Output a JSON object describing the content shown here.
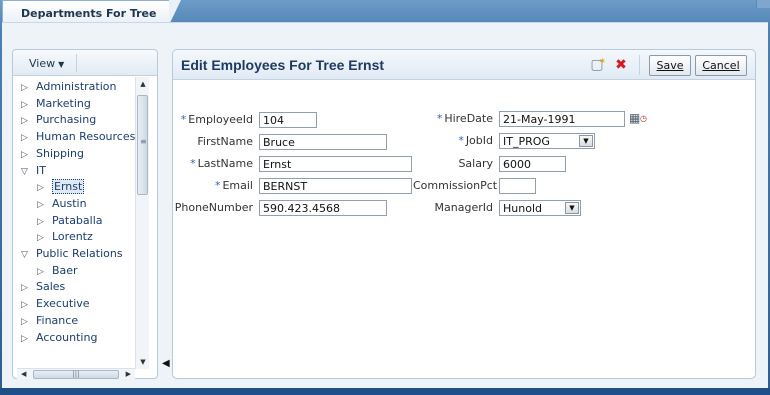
{
  "window": {
    "tab_title": "Departments For Tree"
  },
  "left": {
    "view_label": "View",
    "tree": [
      {
        "label": "Administration",
        "expanded": false,
        "level": 0
      },
      {
        "label": "Marketing",
        "expanded": false,
        "level": 0
      },
      {
        "label": "Purchasing",
        "expanded": false,
        "level": 0
      },
      {
        "label": "Human Resources",
        "expanded": false,
        "level": 0
      },
      {
        "label": "Shipping",
        "expanded": false,
        "level": 0
      },
      {
        "label": "IT",
        "expanded": true,
        "level": 0
      },
      {
        "label": "Ernst",
        "expanded": false,
        "level": 1,
        "selected": true
      },
      {
        "label": "Austin",
        "expanded": false,
        "level": 1
      },
      {
        "label": "Pataballa",
        "expanded": false,
        "level": 1
      },
      {
        "label": "Lorentz",
        "expanded": false,
        "level": 1
      },
      {
        "label": "Public Relations",
        "expanded": true,
        "level": 0
      },
      {
        "label": "Baer",
        "expanded": false,
        "level": 1
      },
      {
        "label": "Sales",
        "expanded": false,
        "level": 0
      },
      {
        "label": "Executive",
        "expanded": false,
        "level": 0
      },
      {
        "label": "Finance",
        "expanded": false,
        "level": 0
      },
      {
        "label": "Accounting",
        "expanded": false,
        "level": 0
      }
    ],
    "collapsed_glyph": "▷",
    "expanded_glyph": "▽"
  },
  "form": {
    "title": "Edit Employees For Tree Ernst",
    "save_label": "Save",
    "cancel_label": "Cancel",
    "required_marker": "*",
    "fields": {
      "employee_id": {
        "label": "EmployeeId",
        "value": "104",
        "required": true
      },
      "first_name": {
        "label": "FirstName",
        "value": "Bruce",
        "required": false
      },
      "last_name": {
        "label": "LastName",
        "value": "Ernst",
        "required": true
      },
      "email": {
        "label": "Email",
        "value": "BERNST",
        "required": true
      },
      "phone": {
        "label": "PhoneNumber",
        "value": "590.423.4568",
        "required": false
      },
      "hire_date": {
        "label": "HireDate",
        "value": "21-May-1991",
        "required": true
      },
      "job_id": {
        "label": "JobId",
        "value": "IT_PROG",
        "required": true
      },
      "salary": {
        "label": "Salary",
        "value": "6000",
        "required": false
      },
      "commission": {
        "label": "CommissionPct",
        "value": "",
        "required": false
      },
      "manager_id": {
        "label": "ManagerId",
        "value": "Hunold",
        "required": false
      }
    }
  },
  "icons": {
    "create": "create-record-icon",
    "delete": "delete-icon",
    "calendar": "calendar-icon"
  },
  "colors": {
    "frame": "#2f5d92",
    "link": "#1b3d72",
    "title": "#1f3a63",
    "required": "#3266b3",
    "delete": "#d41b1b"
  }
}
